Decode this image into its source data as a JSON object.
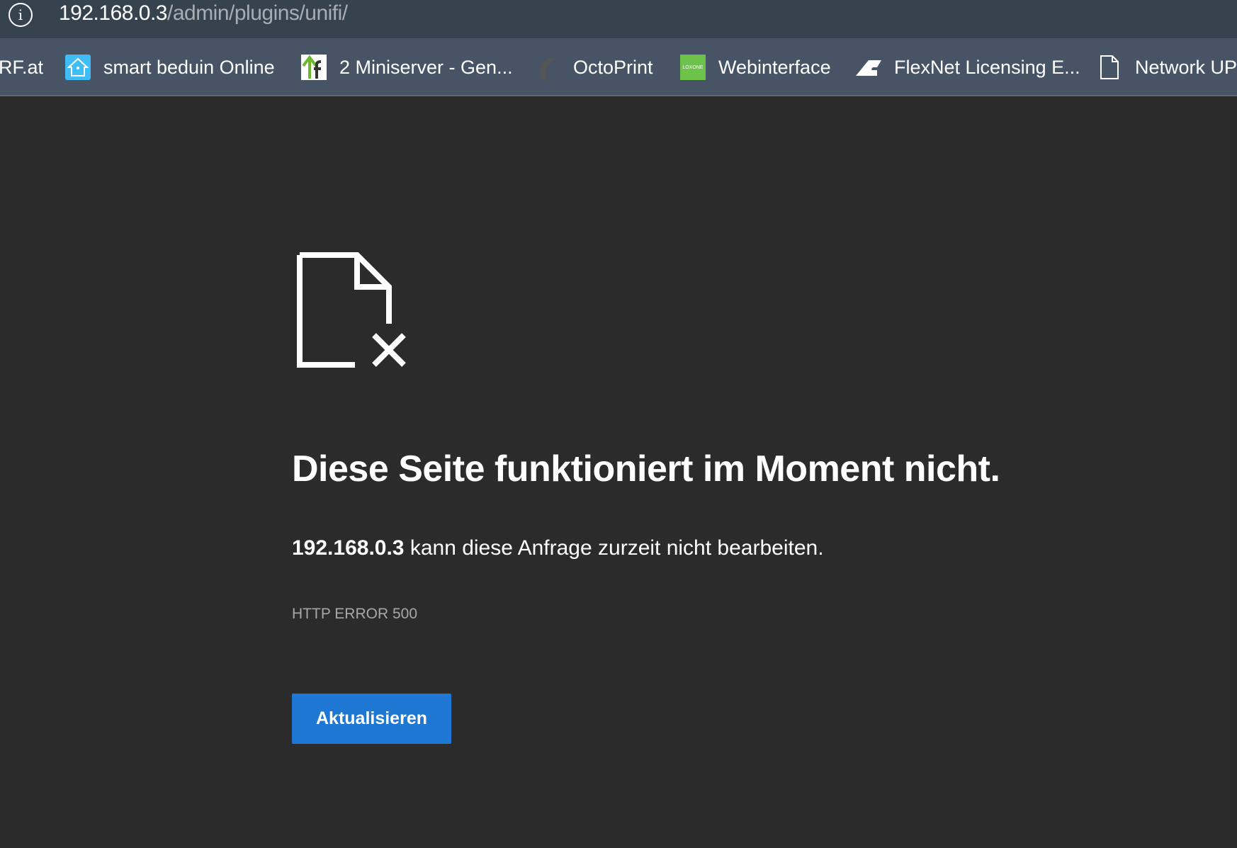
{
  "address_bar": {
    "host": "192.168.0.3",
    "path": "/admin/plugins/unifi/"
  },
  "bookmarks": [
    {
      "label": "RF.at",
      "icon": "none"
    },
    {
      "label": "smart beduin Online",
      "icon": "home-assistant-icon"
    },
    {
      "label": "2 Miniserver - Gen...",
      "icon": "miniserver-icon"
    },
    {
      "label": "OctoPrint",
      "icon": "octoprint-icon"
    },
    {
      "label": "Webinterface",
      "icon": "loxone-icon",
      "icon_text": "LOXONE"
    },
    {
      "label": "FlexNet Licensing E...",
      "icon": "flexnet-icon"
    },
    {
      "label": "Network UPS",
      "icon": "file-icon"
    }
  ],
  "error": {
    "title": "Diese Seite funktioniert im Moment nicht.",
    "host": "192.168.0.3",
    "message": " kann diese Anfrage zurzeit nicht bearbeiten.",
    "code": "HTTP ERROR 500",
    "reload_label": "Aktualisieren"
  },
  "colors": {
    "accent": "#1f77d4",
    "background": "#2b2b2b",
    "toolbar": "#37424f",
    "bookmarks_bar": "#465465"
  }
}
